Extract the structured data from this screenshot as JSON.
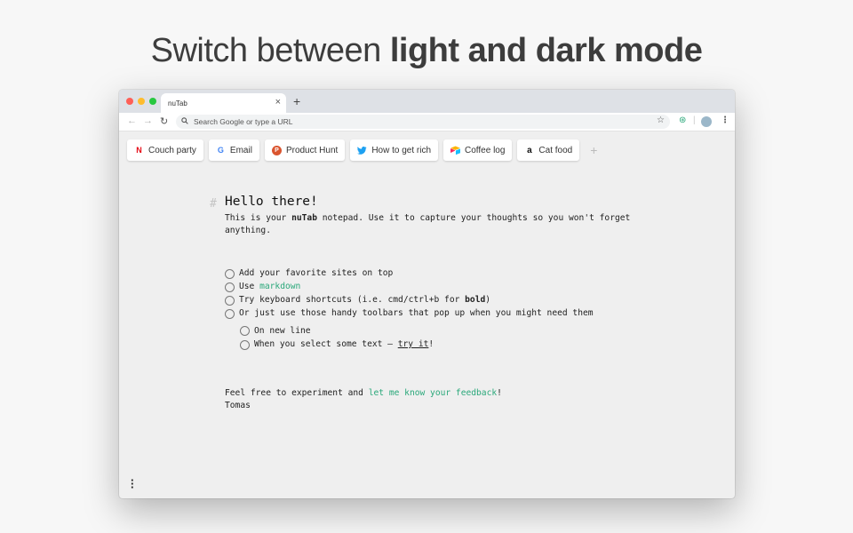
{
  "headline": {
    "prefix": "Switch between ",
    "bold": "light and dark mode"
  },
  "browser": {
    "tab_title": "nuTab",
    "tab_close": "×",
    "new_tab": "+",
    "omnibox_placeholder": "Search Google or type a URL"
  },
  "bookmarks": [
    {
      "label": "Couch party",
      "icon": "netflix-icon",
      "glyph": "N",
      "color": "#e50914"
    },
    {
      "label": "Email",
      "icon": "google-icon",
      "glyph": "G",
      "color": "#4285f4"
    },
    {
      "label": "Product Hunt",
      "icon": "product-hunt-icon",
      "glyph": "P",
      "color": "#da552f"
    },
    {
      "label": "How to get rich",
      "icon": "twitter-icon",
      "glyph": "🐦",
      "color": "#1da1f2"
    },
    {
      "label": "Coffee log",
      "icon": "airtable-icon",
      "glyph": "◆",
      "color": "#f82b60"
    },
    {
      "label": "Cat food",
      "icon": "amazon-icon",
      "glyph": "a",
      "color": "#111111"
    }
  ],
  "bookmark_add": "+",
  "note": {
    "hash": "#",
    "title": "Hello there!",
    "intro_a": "This is your ",
    "intro_bold": "nuTab",
    "intro_b": " notepad. Use it to capture your thoughts so you won't forget anything.",
    "tasks": {
      "t1": "Add your favorite sites on top",
      "t2_a": "Use ",
      "t2_link": "markdown",
      "t3_a": "Try keyboard shortcuts (i.e. cmd/ctrl+b for ",
      "t3_bold": "bold",
      "t3_b": ")",
      "t4": "Or just use those handy toolbars that pop up when you might need them",
      "s1": "On new line",
      "s2_a": "When you select some text – ",
      "s2_link": "try it",
      "s2_b": "!"
    },
    "footer_a": "Feel free to experiment and ",
    "footer_link": "let me know your feedback",
    "footer_b": "!",
    "signature": "Tomas"
  },
  "colors": {
    "accent": "#2aa87a",
    "window_bg": "#efefef",
    "tabstrip": "#dee1e6"
  }
}
